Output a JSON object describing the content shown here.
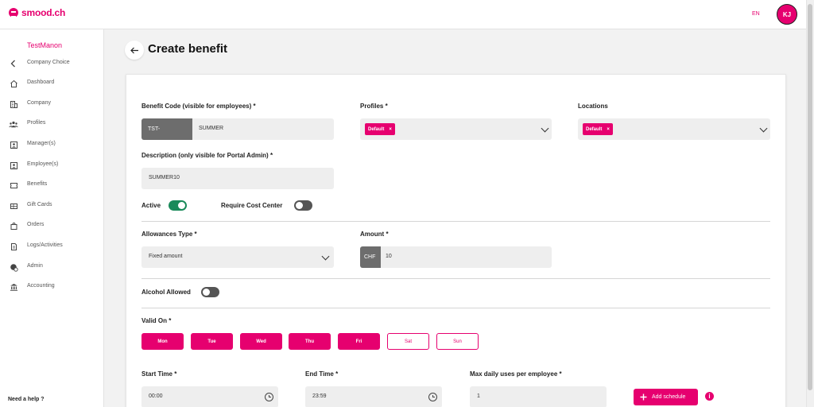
{
  "header": {
    "brand": "smood.ch",
    "language": "EN",
    "user_initials": "KJ"
  },
  "sidebar": {
    "company_name": "TestManon",
    "items": [
      {
        "label": "Company Choice",
        "icon": "chevron-left-icon"
      },
      {
        "label": "Dashboard",
        "icon": "home-icon"
      },
      {
        "label": "Company",
        "icon": "building-icon"
      },
      {
        "label": "Profiles",
        "icon": "users-group-icon"
      },
      {
        "label": "Manager(s)",
        "icon": "id-card-icon"
      },
      {
        "label": "Employee(s)",
        "icon": "id-card-icon"
      },
      {
        "label": "Benefits",
        "icon": "ticket-icon"
      },
      {
        "label": "Gift Cards",
        "icon": "gift-card-icon"
      },
      {
        "label": "Orders",
        "icon": "shopping-bag-icon"
      },
      {
        "label": "Logs/Activities",
        "icon": "document-icon"
      },
      {
        "label": "Admin",
        "icon": "admin-globe-icon"
      },
      {
        "label": "Accounting",
        "icon": "bank-icon"
      }
    ],
    "help_label": "Need a help ?"
  },
  "page": {
    "title": "Create benefit"
  },
  "form": {
    "benefit_code": {
      "label": "Benefit Code (visible for employees) *",
      "prefix": "TST-",
      "value": "SUMMER"
    },
    "profiles": {
      "label": "Profiles *",
      "chips": [
        "Default"
      ]
    },
    "locations": {
      "label": "Locations",
      "chips": [
        "Default"
      ]
    },
    "description": {
      "label": "Description (only visible for Portal Admin) *",
      "value": "SUMMER10"
    },
    "active": {
      "label": "Active",
      "on": true
    },
    "require_cost_center": {
      "label": "Require Cost Center",
      "on": false
    },
    "allowances_type": {
      "label": "Allowances Type *",
      "value": "Fixed amount"
    },
    "amount": {
      "label": "Amount *",
      "currency": "CHF",
      "value": "10"
    },
    "alcohol_allowed": {
      "label": "Alcohol Allowed",
      "on": false
    },
    "valid_on": {
      "label": "Valid On *",
      "days": [
        {
          "label": "Mon",
          "selected": true
        },
        {
          "label": "Tue",
          "selected": true
        },
        {
          "label": "Wed",
          "selected": true
        },
        {
          "label": "Thu",
          "selected": true
        },
        {
          "label": "Fri",
          "selected": true
        },
        {
          "label": "Sat",
          "selected": false
        },
        {
          "label": "Sun",
          "selected": false
        }
      ]
    },
    "start_time": {
      "label": "Start Time *",
      "value": "00:00"
    },
    "end_time": {
      "label": "End Time *",
      "value": "23:59"
    },
    "max_daily_uses": {
      "label": "Max daily uses per employee *",
      "value": "1"
    },
    "add_schedule_label": "Add schedule",
    "chip_remove_glyph": "×",
    "info_glyph": "i"
  },
  "colors": {
    "accent": "#e6006f",
    "toggle_on": "#1a8a5a",
    "toggle_off": "#555555"
  }
}
